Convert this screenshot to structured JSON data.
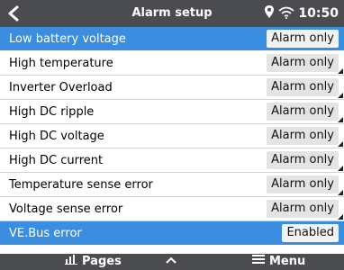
{
  "header": {
    "title": "Alarm setup",
    "time": "10:50"
  },
  "rows": [
    {
      "label": "Low battery voltage",
      "value": "Alarm only",
      "highlight": true
    },
    {
      "label": "High temperature",
      "value": "Alarm only"
    },
    {
      "label": "Inverter Overload",
      "value": "Alarm only"
    },
    {
      "label": "High DC ripple",
      "value": "Alarm only"
    },
    {
      "label": "High DC voltage",
      "value": "Alarm only"
    },
    {
      "label": "High DC current",
      "value": "Alarm only"
    },
    {
      "label": "Temperature sense error",
      "value": "Alarm only"
    },
    {
      "label": "Voltage sense error",
      "value": "Alarm only"
    },
    {
      "label": "VE.Bus error",
      "value": "Enabled",
      "highlight": true
    }
  ],
  "footer": {
    "pages_label": "Pages",
    "menu_label": "Menu"
  },
  "colors": {
    "header_bg": "#4a4c4f",
    "highlight_bg": "#3b8de0"
  },
  "icons": [
    "back-icon",
    "location-icon",
    "wifi-icon",
    "pages-icon",
    "up-icon",
    "menu-icon"
  ]
}
